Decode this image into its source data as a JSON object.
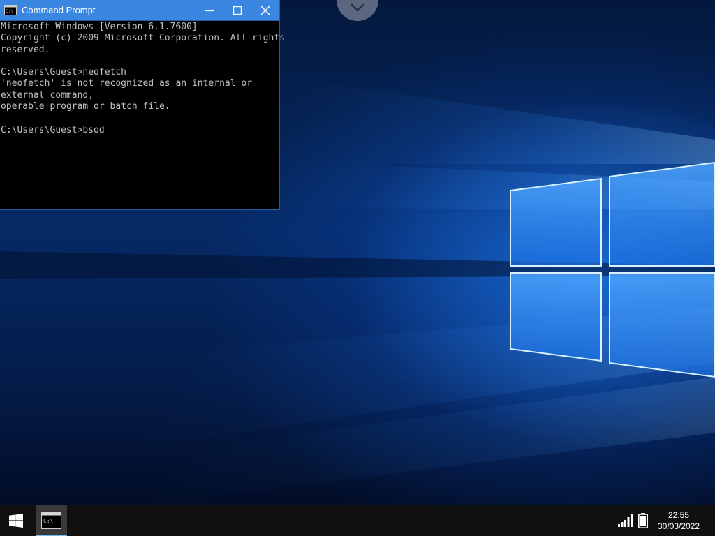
{
  "cmd_window": {
    "title": "Command Prompt",
    "title_icon": "console-icon",
    "controls": {
      "minimize_icon": "minimize-icon",
      "maximize_icon": "maximize-icon",
      "close_icon": "close-icon"
    },
    "lines": [
      "Microsoft Windows [Version 6.1.7600]",
      "Copyright (c) 2009 Microsoft Corporation. All rights",
      "reserved.",
      "",
      "C:\\Users\\Guest>neofetch",
      "'neofetch' is not recognized as an internal or",
      "external command,",
      "operable program or batch file.",
      "",
      "C:\\Users\\Guest>bsod"
    ]
  },
  "remote_session": {
    "handle_icon": "chevron-down-icon"
  },
  "taskbar": {
    "start_icon": "windows-logo-icon",
    "apps": [
      {
        "icon": "console-icon",
        "active": true
      }
    ],
    "tray": {
      "signal_icon": "signal-strength-icon",
      "battery_icon": "battery-icon",
      "time": "22:55",
      "date": "30/03/2022"
    }
  },
  "colors": {
    "titlebar": "#3a86e0",
    "console_bg": "#000000",
    "console_fg": "#c0c0c0",
    "taskbar_bg": "#101010",
    "active_app_bg": "#3a3a3a",
    "active_app_underline": "#76b9ed"
  }
}
